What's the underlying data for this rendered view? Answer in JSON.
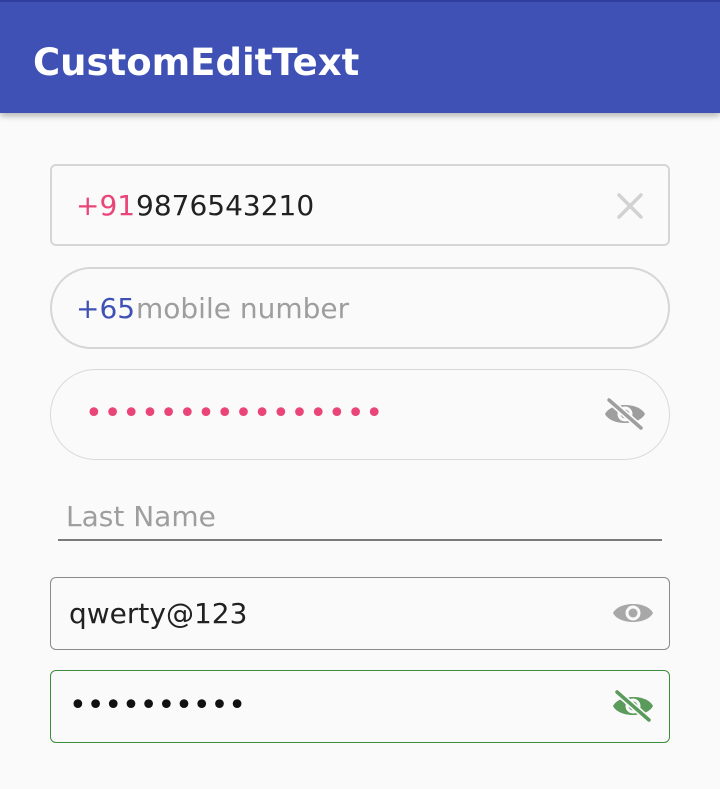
{
  "app_bar": {
    "title": "CustomEditText",
    "color": "#3f51b5"
  },
  "fields": {
    "phone_india": {
      "country_code": "+91",
      "value": "9876543210",
      "trailing_icon": "clear-icon",
      "code_color": "#ea4579"
    },
    "phone_singapore": {
      "country_code": "+65",
      "placeholder": "mobile number",
      "code_color": "#3f51b5"
    },
    "password_rounded": {
      "masked_value": "••••••••••••••••",
      "trailing_icon": "visibility-off-icon",
      "text_color": "#ea4579"
    },
    "last_name": {
      "placeholder": "Last Name"
    },
    "password_visible": {
      "value": "qwerty@123",
      "trailing_icon": "visibility-icon"
    },
    "password_masked": {
      "masked_value": "••••••••••",
      "trailing_icon": "visibility-off-icon",
      "accent_color": "#3c8c3c"
    }
  }
}
